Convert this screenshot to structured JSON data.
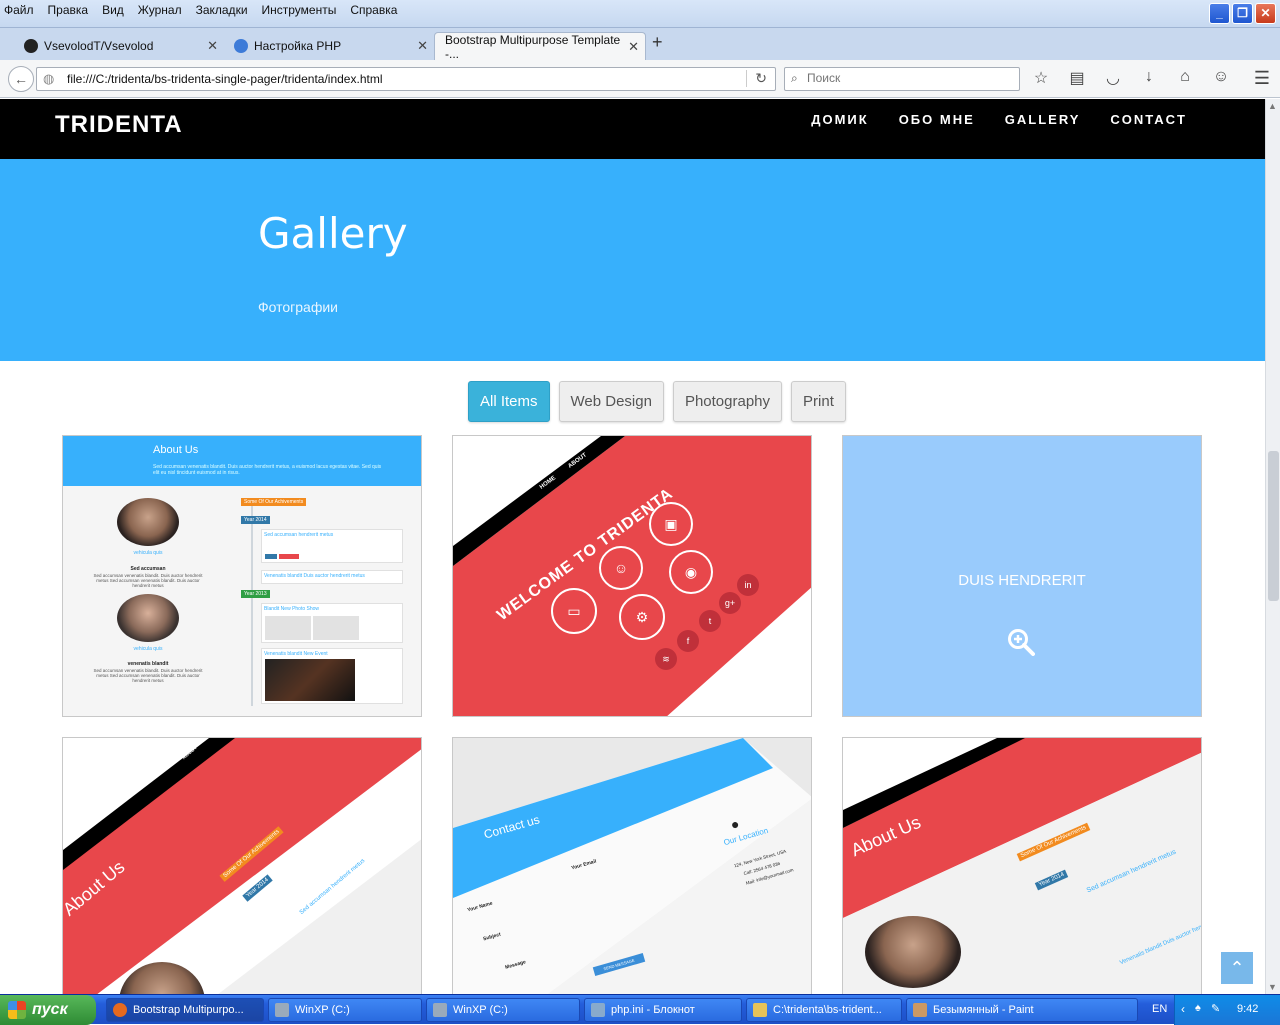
{
  "browser": {
    "menu": [
      "Файл",
      "Правка",
      "Вид",
      "Журнал",
      "Закладки",
      "Инструменты",
      "Справка"
    ],
    "tabs": [
      {
        "title": "VsevolodT/Vsevolod"
      },
      {
        "title": "Настройка PHP"
      },
      {
        "title": "Bootstrap Multipurpose Template -..."
      }
    ],
    "url": "file:///C:/tridenta/bs-tridenta-single-pager/tridenta/index.html",
    "search_placeholder": "Поиск"
  },
  "site": {
    "brand": "TRIDENTA",
    "nav": [
      "ДОМИК",
      "ОБО МНЕ",
      "GALLERY",
      "CONTACT"
    ],
    "hero_title": "Gallery",
    "hero_subtitle": "Фотографии",
    "filters": [
      "All Items",
      "Web Design",
      "Photography",
      "Print"
    ],
    "active_filter": "All Items",
    "tiles": {
      "about_title": "About Us",
      "about_text": "Sed accumsan venenatis blandit. Duis auctor hendrerit metus, a euismod lacus egestas vitae. Sed quis elit eu nisl tincidunt euismod at in risus.",
      "person1_link": "vehicula quis",
      "person1_name": "Sed accumsan",
      "person1_text": "Sed accumsan venenatis blandit. Duis auctor hendrerit metus Sed accumsan venenatis blandit. Duis auctor hendrerit metus",
      "person2_link": "vehicula quis",
      "person2_name": "venenatis blandit",
      "person2_text": "Sed accumsan venenatis blandit. Duis auctor hendrerit metus Sed accumsan venenatis blandit. Duis auctor hendrerit metus",
      "achievements": "Some Of Our Achivements",
      "year2014": "Year 2014",
      "year2013": "Year 2013",
      "ev1": "Sed accumsan hendrerit metus",
      "ev2": "Venenatis blandit Duis auctor hendrerit metus",
      "ev3": "Blandit New Photo Show",
      "ev4": "Venenatis blandit New Event",
      "welcome": "WELCOME TO TRIDENTA",
      "welcome_nav": [
        "HOME",
        "ABOUT"
      ],
      "hover_label": "DUIS HENDRERIT",
      "contact_title": "Contact us",
      "contact_location": "Our Location",
      "contact_fields": [
        "Your Name",
        "Your Email",
        "Subject",
        "Message"
      ],
      "contact_button": "SEND MESSAGE",
      "address": [
        "124, New York Street, USA",
        "Call: 2564 478 036",
        "Mail: info@yourmail.com"
      ]
    }
  },
  "taskbar": {
    "start": "пуск",
    "items": [
      "Bootstrap Multipurpo...",
      "WinXP (C:)",
      "WinXP (C:)",
      "php.ini - Блокнот",
      "C:\\tridenta\\bs-trident...",
      "Безымянный - Paint"
    ],
    "lang": "EN",
    "clock": "9:42"
  },
  "colors": {
    "hero": "#37b0fc",
    "accent_red": "#e8474b",
    "filter_active": "#3ab2da",
    "hover_tile": "#99cbfc"
  }
}
